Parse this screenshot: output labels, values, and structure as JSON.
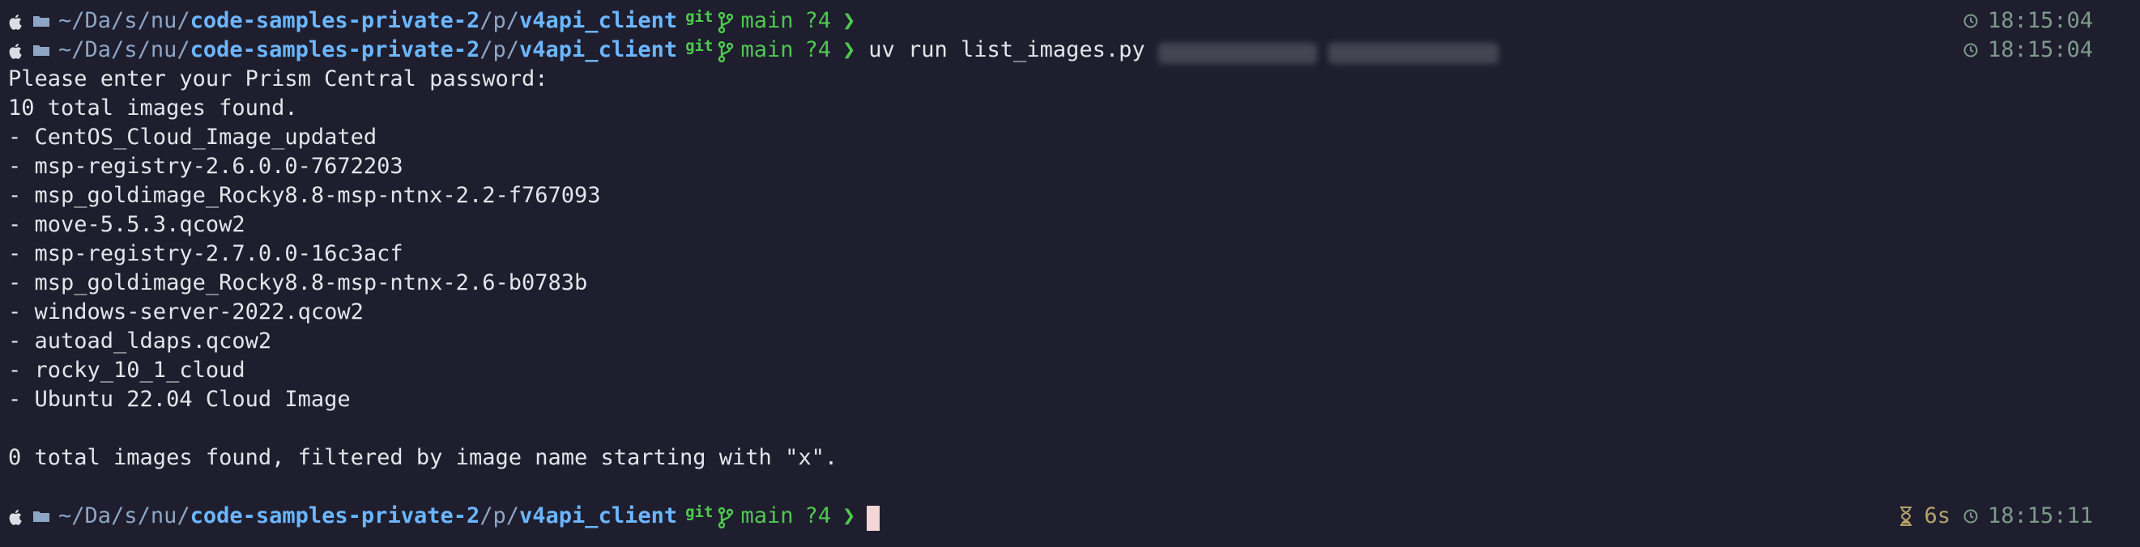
{
  "prompt": {
    "path_home": "~/",
    "path_segments": [
      "Da",
      "s",
      "nu"
    ],
    "repo": "code-samples-private-2",
    "sub": "p",
    "dir": "v4api_client",
    "git_label": "git",
    "branch": "main",
    "status": "?4",
    "arrow": "❯"
  },
  "lines": {
    "l1": {
      "time": "18:15:04"
    },
    "l2": {
      "command": "uv run list_images.py",
      "time": "18:15:04"
    },
    "last": {
      "duration": "6s",
      "time": "18:15:11"
    }
  },
  "output": [
    "Please enter your Prism Central password:",
    "10 total images found.",
    "- CentOS_Cloud_Image_updated",
    "- msp-registry-2.6.0.0-7672203",
    "- msp_goldimage_Rocky8.8-msp-ntnx-2.2-f767093",
    "- move-5.5.3.qcow2",
    "- msp-registry-2.7.0.0-16c3acf",
    "- msp_goldimage_Rocky8.8-msp-ntnx-2.6-b0783b",
    "- windows-server-2022.qcow2",
    "- autoad_ldaps.qcow2",
    "- rocky_10_1_cloud",
    "- Ubuntu 22.04 Cloud Image",
    "",
    "0 total images found, filtered by image name starting with \"x\"."
  ],
  "colors": {
    "background": "#1e1e2e",
    "path": "#6cb6ff",
    "git": "#4ec94e",
    "time": "#7d9a8a",
    "cursor": "#f3d7d7"
  }
}
